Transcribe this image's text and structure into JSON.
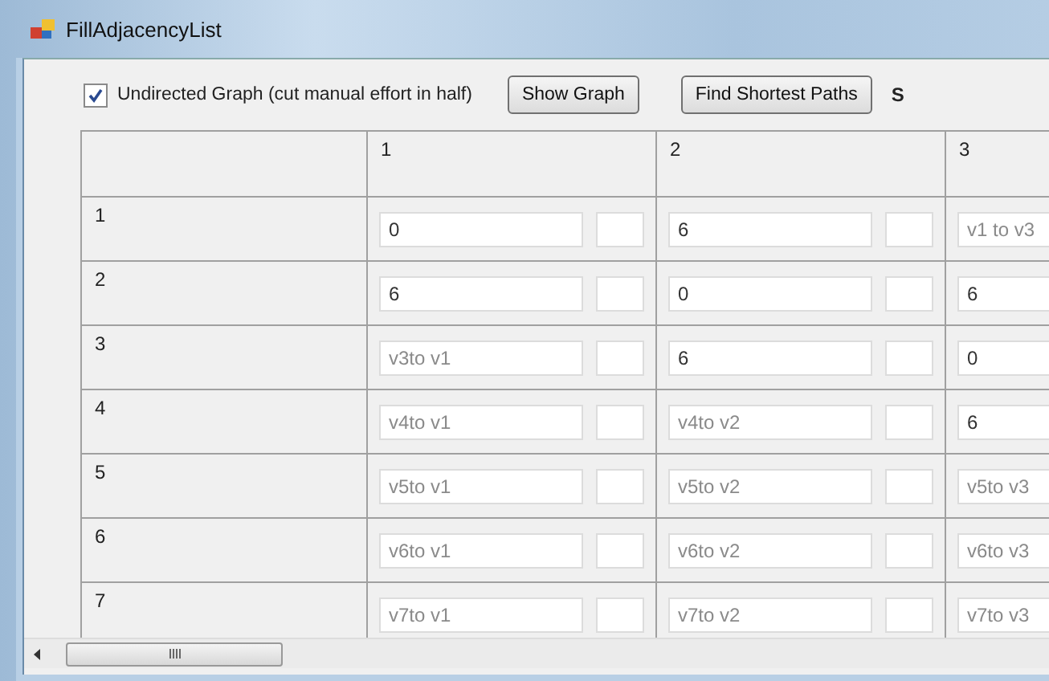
{
  "window": {
    "title": "FillAdjacencyList"
  },
  "toolbar": {
    "undirected": {
      "label": "Undirected Graph (cut manual effort in half)",
      "checked": true
    },
    "buttons": [
      "Show Graph",
      "Find Shortest Paths"
    ],
    "cut_label": "S"
  },
  "grid": {
    "columns": [
      "1",
      "2",
      "3"
    ],
    "rows": [
      {
        "label": "1",
        "cells": [
          {
            "value": "0"
          },
          {
            "value": "6"
          },
          {
            "placeholder": "v1 to v3"
          }
        ]
      },
      {
        "label": "2",
        "cells": [
          {
            "value": "6"
          },
          {
            "value": "0"
          },
          {
            "value": "6"
          }
        ]
      },
      {
        "label": "3",
        "cells": [
          {
            "placeholder": "v3to v1"
          },
          {
            "value": "6"
          },
          {
            "value": "0"
          }
        ]
      },
      {
        "label": "4",
        "cells": [
          {
            "placeholder": "v4to v1"
          },
          {
            "placeholder": "v4to v2"
          },
          {
            "value": "6"
          }
        ]
      },
      {
        "label": "5",
        "cells": [
          {
            "placeholder": "v5to v1"
          },
          {
            "placeholder": "v5to v2"
          },
          {
            "placeholder": "v5to v3"
          }
        ]
      },
      {
        "label": "6",
        "cells": [
          {
            "placeholder": "v6to v1"
          },
          {
            "placeholder": "v6to v2"
          },
          {
            "placeholder": "v6to v3"
          }
        ]
      },
      {
        "label": "7",
        "cells": [
          {
            "placeholder": "v7to v1"
          },
          {
            "placeholder": "v7to v2"
          },
          {
            "placeholder": "v7to v3"
          }
        ]
      }
    ]
  }
}
